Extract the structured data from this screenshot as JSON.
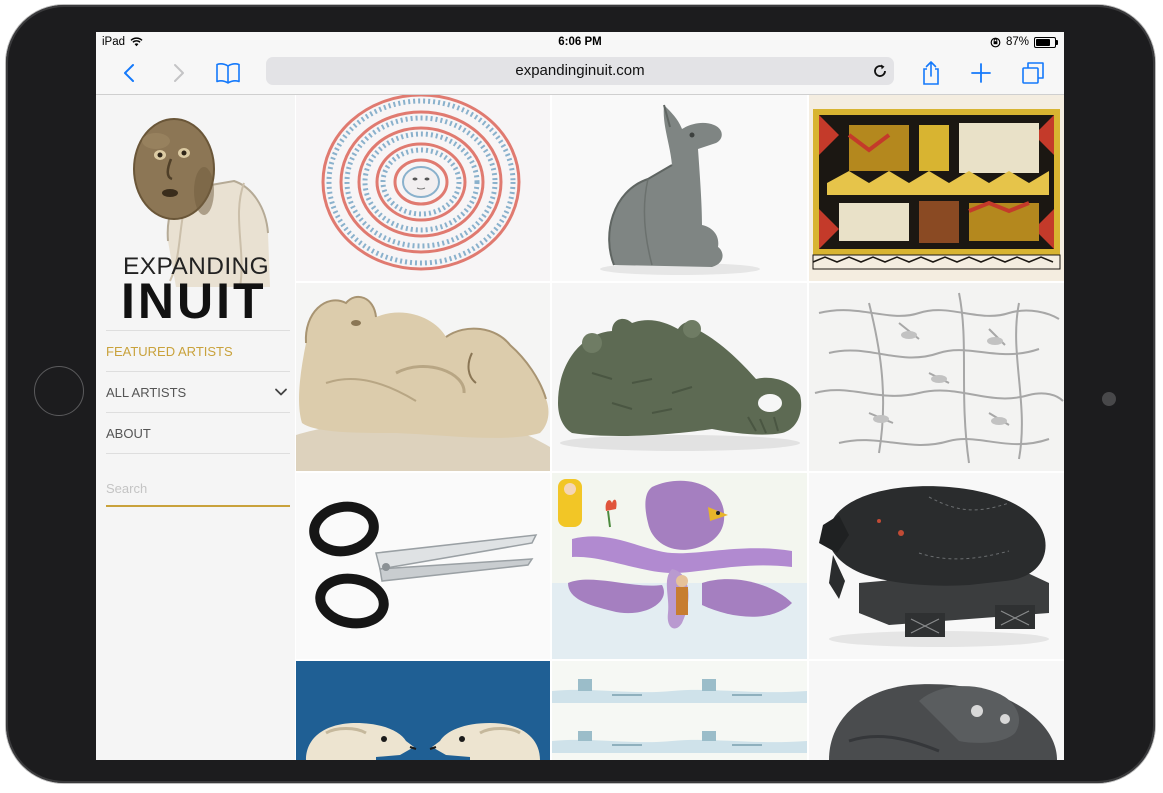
{
  "device": {
    "name": "iPad"
  },
  "status_bar": {
    "carrier": "iPad",
    "time": "6:06 PM",
    "battery": "87%",
    "battery_level": 0.87
  },
  "browser": {
    "url": "expandinginuit.com",
    "icons": [
      "back-icon",
      "forward-icon",
      "bookmarks-icon",
      "reload-icon",
      "share-icon",
      "new-tab-icon",
      "tabs-icon"
    ]
  },
  "sidebar": {
    "logo": {
      "line1": "EXPANDING",
      "line2": "INUIT"
    },
    "nav": [
      {
        "label": "FEATURED ARTISTS",
        "active": true
      },
      {
        "label": "ALL ARTISTS",
        "has_dropdown": true
      },
      {
        "label": "ABOUT"
      }
    ],
    "search": {
      "placeholder": "Search",
      "value": ""
    }
  },
  "gallery": {
    "columns": 3,
    "tiles": [
      {
        "subject": "spiral-drawing"
      },
      {
        "subject": "stone-animal-sculpture"
      },
      {
        "subject": "patterned-wall-hanging"
      },
      {
        "subject": "carved-figure"
      },
      {
        "subject": "green-stone-bear"
      },
      {
        "subject": "bird-branch-drawing"
      },
      {
        "subject": "scissors-drawing"
      },
      {
        "subject": "octopus-figure-drawing"
      },
      {
        "subject": "black-stone-animal"
      },
      {
        "subject": "fox-heads-artwork"
      },
      {
        "subject": "landscape-drawing"
      },
      {
        "subject": "dark-stone-animal"
      }
    ]
  }
}
